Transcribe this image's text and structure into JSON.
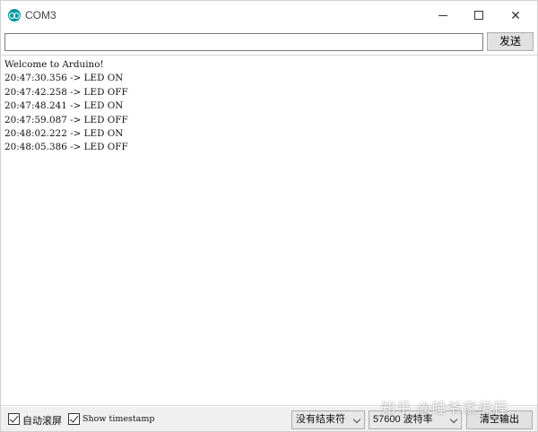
{
  "window": {
    "title": "COM3",
    "app_icon": "arduino-logo-icon",
    "accent_color": "#00979c"
  },
  "input": {
    "value": "",
    "send_label": "发送"
  },
  "output": {
    "lines": [
      "Welcome to Arduino!",
      "20:47:30.356 -> LED ON",
      "20:47:42.258 -> LED OFF",
      "20:47:48.241 -> LED ON",
      "20:47:59.087 -> LED OFF",
      "20:48:02.222 -> LED ON",
      "20:48:05.386 -> LED OFF"
    ]
  },
  "footer": {
    "autoscroll_label": "自动滚屏",
    "autoscroll_checked": true,
    "timestamp_label": "Show timestamp",
    "timestamp_checked": true,
    "line_ending": "没有结束符",
    "baud_rate": "57600 波特率",
    "clear_label": "清空输出"
  },
  "watermark": "知乎 @睡爷家编程"
}
